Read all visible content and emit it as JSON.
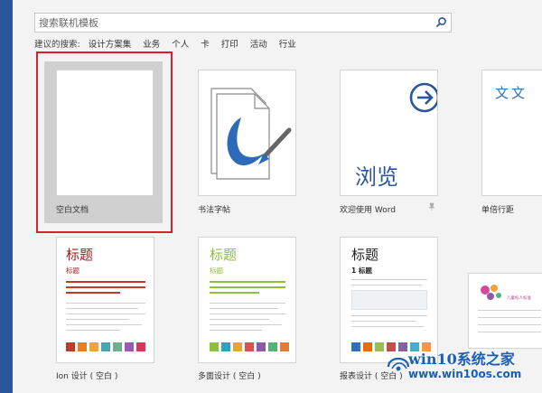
{
  "search": {
    "placeholder": "搜索联机模板"
  },
  "suggested": {
    "label": "建议的搜索:",
    "items": [
      "设计方案集",
      "业务",
      "个人",
      "卡",
      "打印",
      "活动",
      "行业"
    ]
  },
  "templates": [
    {
      "caption": "空白文档"
    },
    {
      "caption": "书法字帖"
    },
    {
      "caption": "欢迎使用 Word"
    },
    {
      "caption": "单倍行距",
      "thumb_text": "文文"
    },
    {
      "caption": "Ion 设计 ( 空白 )",
      "title": "标题",
      "subtitle": "标题"
    },
    {
      "caption": "多面设计 ( 空白 )",
      "title": "标题",
      "subtitle": "标题"
    },
    {
      "caption": "报表设计 ( 空白 )",
      "title": "标题",
      "subtitle": "1 标题"
    },
    {
      "thumb_text": "儿童标人标准"
    }
  ],
  "welcome_thumb_text": "浏览",
  "watermark": {
    "title": "win10系统之家",
    "url": "www.win10os.com"
  },
  "colors": {
    "accent": "#2b579a",
    "selection": "#d6212a",
    "ion_red": "#a31f21",
    "facet_green": "#8fbf3f",
    "report_blue": "#2f72b7"
  },
  "swatch_colors": [
    "#c0392b",
    "#e67e22",
    "#f2a33c",
    "#4aa3b5",
    "#6fae8e",
    "#9b59b6",
    "#d9355a"
  ]
}
